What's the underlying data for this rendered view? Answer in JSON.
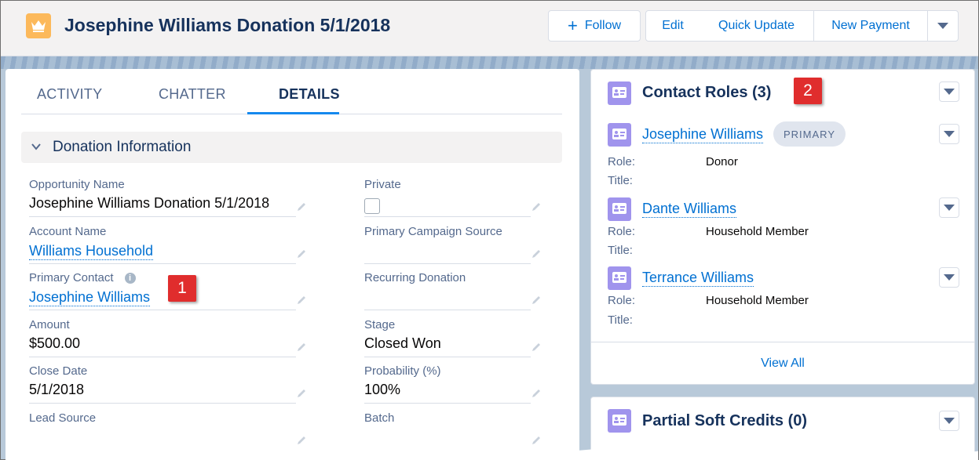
{
  "header": {
    "title": "Josephine Williams Donation 5/1/2018",
    "buttons": {
      "follow": "Follow",
      "edit": "Edit",
      "quick_update": "Quick Update",
      "new_payment": "New Payment"
    }
  },
  "tabs": [
    {
      "label": "ACTIVITY"
    },
    {
      "label": "CHATTER"
    },
    {
      "label": "DETAILS",
      "active": true
    }
  ],
  "section": {
    "title": "Donation Information"
  },
  "fields": {
    "opportunity_name": {
      "label": "Opportunity Name",
      "value": "Josephine Williams Donation 5/1/2018"
    },
    "private": {
      "label": "Private",
      "checked": false
    },
    "account_name": {
      "label": "Account Name",
      "value": "Williams Household"
    },
    "primary_campaign_source": {
      "label": "Primary Campaign Source",
      "value": ""
    },
    "primary_contact": {
      "label": "Primary Contact",
      "value": "Josephine Williams"
    },
    "recurring_donation": {
      "label": "Recurring Donation",
      "value": ""
    },
    "amount": {
      "label": "Amount",
      "value": "$500.00"
    },
    "stage": {
      "label": "Stage",
      "value": "Closed Won"
    },
    "close_date": {
      "label": "Close Date",
      "value": "5/1/2018"
    },
    "probability": {
      "label": "Probability (%)",
      "value": "100%"
    },
    "lead_source": {
      "label": "Lead Source",
      "value": ""
    },
    "batch": {
      "label": "Batch",
      "value": ""
    }
  },
  "callouts": {
    "one": "1",
    "two": "2"
  },
  "contact_roles": {
    "title": "Contact Roles (3)",
    "role_label": "Role:",
    "title_label": "Title:",
    "contacts": [
      {
        "name": "Josephine Williams",
        "badge": "PRIMARY",
        "role": "Donor",
        "title": ""
      },
      {
        "name": "Dante Williams",
        "role": "Household Member",
        "title": ""
      },
      {
        "name": "Terrance Williams",
        "role": "Household Member",
        "title": ""
      }
    ],
    "view_all": "View All"
  },
  "partial_soft_credits": {
    "title": "Partial Soft Credits (0)"
  },
  "colors": {
    "link": "#0070d2",
    "record_icon": "#fcb95b",
    "contact_icon": "#a094ed",
    "callout": "#e02d2d"
  }
}
